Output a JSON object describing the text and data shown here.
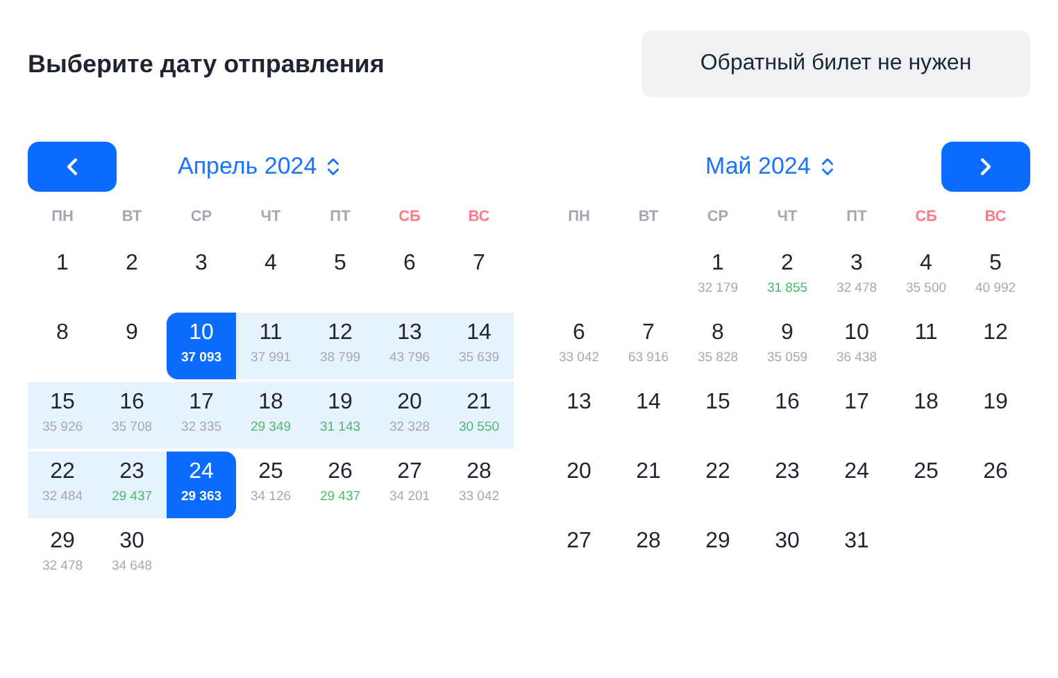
{
  "title": "Выберите дату отправления",
  "return_button": "Обратный билет не нужен",
  "months": [
    {
      "label": "Апрель 2024",
      "kind": "first",
      "weekdays": [
        {
          "label": "ПН",
          "weekend": false
        },
        {
          "label": "ВТ",
          "weekend": false
        },
        {
          "label": "СР",
          "weekend": false
        },
        {
          "label": "ЧТ",
          "weekend": false
        },
        {
          "label": "ПТ",
          "weekend": false
        },
        {
          "label": "СБ",
          "weekend": true
        },
        {
          "label": "ВС",
          "weekend": true
        }
      ],
      "weeks": [
        [
          {
            "kind": "day",
            "day": "1"
          },
          {
            "kind": "day",
            "day": "2"
          },
          {
            "kind": "day",
            "day": "3"
          },
          {
            "kind": "day",
            "day": "4"
          },
          {
            "kind": "day",
            "day": "5"
          },
          {
            "kind": "day",
            "day": "6"
          },
          {
            "kind": "day",
            "day": "7"
          }
        ],
        [
          {
            "kind": "day",
            "day": "8"
          },
          {
            "kind": "day",
            "day": "9"
          },
          {
            "kind": "day",
            "day": "10",
            "price": "37 093",
            "selected": true
          },
          {
            "kind": "day",
            "day": "11",
            "price": "37 991",
            "cheap": false,
            "in_range": true
          },
          {
            "kind": "day",
            "day": "12",
            "price": "38 799",
            "cheap": false,
            "in_range": true
          },
          {
            "kind": "day",
            "day": "13",
            "price": "43 796",
            "cheap": false,
            "in_range": true
          },
          {
            "kind": "day",
            "day": "14",
            "price": "35 639",
            "cheap": false,
            "in_range": true
          }
        ],
        [
          {
            "kind": "day",
            "day": "15",
            "price": "35 926",
            "cheap": false,
            "in_range": true
          },
          {
            "kind": "day",
            "day": "16",
            "price": "35 708",
            "cheap": false,
            "in_range": true
          },
          {
            "kind": "day",
            "day": "17",
            "price": "32 335",
            "cheap": false,
            "in_range": true
          },
          {
            "kind": "day",
            "day": "18",
            "price": "29 349",
            "cheap": true,
            "in_range": true
          },
          {
            "kind": "day",
            "day": "19",
            "price": "31 143",
            "cheap": true,
            "in_range": true
          },
          {
            "kind": "day",
            "day": "20",
            "price": "32 328",
            "cheap": false,
            "in_range": true
          },
          {
            "kind": "day",
            "day": "21",
            "price": "30 550",
            "cheap": true,
            "in_range": true
          }
        ],
        [
          {
            "kind": "day",
            "day": "22",
            "price": "32 484",
            "cheap": false,
            "in_range": true
          },
          {
            "kind": "day",
            "day": "23",
            "price": "29 437",
            "cheap": true,
            "in_range": true
          },
          {
            "kind": "day",
            "day": "24",
            "price": "29 363",
            "selected": true
          },
          {
            "kind": "day",
            "day": "25",
            "price": "34 126",
            "cheap": false
          },
          {
            "kind": "day",
            "day": "26",
            "price": "29 437",
            "cheap": true
          },
          {
            "kind": "day",
            "day": "27",
            "price": "34 201",
            "cheap": false
          },
          {
            "kind": "day",
            "day": "28",
            "price": "33 042",
            "cheap": false
          }
        ],
        [
          {
            "kind": "day",
            "day": "29",
            "price": "32 478",
            "cheap": false
          },
          {
            "kind": "day",
            "day": "30",
            "price": "34 648",
            "cheap": false
          }
        ]
      ]
    },
    {
      "label": "Май 2024",
      "kind": "last",
      "weekdays": [
        {
          "label": "ПН",
          "weekend": false
        },
        {
          "label": "ВТ",
          "weekend": false
        },
        {
          "label": "СР",
          "weekend": false
        },
        {
          "label": "ЧТ",
          "weekend": false
        },
        {
          "label": "ПТ",
          "weekend": false
        },
        {
          "label": "СБ",
          "weekend": true
        },
        {
          "label": "ВС",
          "weekend": true
        }
      ],
      "weeks": [
        [
          {
            "kind": "empty"
          },
          {
            "kind": "empty"
          },
          {
            "kind": "day",
            "day": "1",
            "price": "32 179",
            "cheap": false
          },
          {
            "kind": "day",
            "day": "2",
            "price": "31 855",
            "cheap": true
          },
          {
            "kind": "day",
            "day": "3",
            "price": "32 478",
            "cheap": false
          },
          {
            "kind": "day",
            "day": "4",
            "price": "35 500",
            "cheap": false
          },
          {
            "kind": "day",
            "day": "5",
            "price": "40 992",
            "cheap": false
          }
        ],
        [
          {
            "kind": "day",
            "day": "6",
            "price": "33 042",
            "cheap": false
          },
          {
            "kind": "day",
            "day": "7",
            "price": "63 916",
            "cheap": false
          },
          {
            "kind": "day",
            "day": "8",
            "price": "35 828",
            "cheap": false
          },
          {
            "kind": "day",
            "day": "9",
            "price": "35 059",
            "cheap": false
          },
          {
            "kind": "day",
            "day": "10",
            "price": "36 438",
            "cheap": false
          },
          {
            "kind": "day",
            "day": "11"
          },
          {
            "kind": "day",
            "day": "12"
          }
        ],
        [
          {
            "kind": "day",
            "day": "13"
          },
          {
            "kind": "day",
            "day": "14"
          },
          {
            "kind": "day",
            "day": "15"
          },
          {
            "kind": "day",
            "day": "16"
          },
          {
            "kind": "day",
            "day": "17"
          },
          {
            "kind": "day",
            "day": "18"
          },
          {
            "kind": "day",
            "day": "19"
          }
        ],
        [
          {
            "kind": "day",
            "day": "20"
          },
          {
            "kind": "day",
            "day": "21"
          },
          {
            "kind": "day",
            "day": "22"
          },
          {
            "kind": "day",
            "day": "23"
          },
          {
            "kind": "day",
            "day": "24"
          },
          {
            "kind": "day",
            "day": "25"
          },
          {
            "kind": "day",
            "day": "26"
          }
        ],
        [
          {
            "kind": "day",
            "day": "27"
          },
          {
            "kind": "day",
            "day": "28"
          },
          {
            "kind": "day",
            "day": "29"
          },
          {
            "kind": "day",
            "day": "30"
          },
          {
            "kind": "day",
            "day": "31"
          }
        ]
      ]
    }
  ]
}
